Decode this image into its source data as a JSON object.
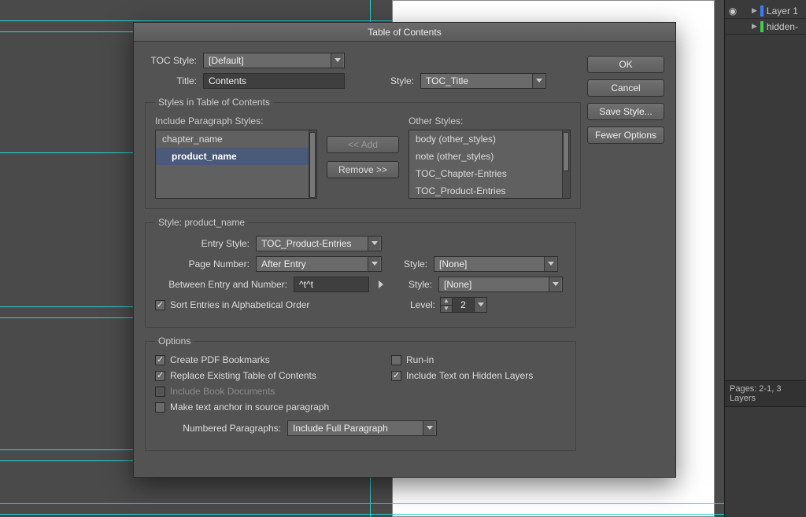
{
  "dialog": {
    "title": "Table of Contents",
    "toc_style_label": "TOC Style:",
    "toc_style_value": "[Default]",
    "title_label": "Title:",
    "title_value": "Contents",
    "title_style_label": "Style:",
    "title_style_value": "TOC_Title",
    "buttons": {
      "ok": "OK",
      "cancel": "Cancel",
      "save_style": "Save Style...",
      "fewer_options": "Fewer Options"
    },
    "styles_group": {
      "legend": "Styles in Table of Contents",
      "include_label": "Include Paragraph Styles:",
      "other_label": "Other Styles:",
      "include_list": [
        "chapter_name",
        "product_name"
      ],
      "include_selected": "product_name",
      "other_list": [
        "body (other_styles)",
        "note (other_styles)",
        "TOC_Chapter-Entries",
        "TOC_Product-Entries"
      ],
      "add_btn": "<< Add",
      "remove_btn": "Remove >>"
    },
    "style_detail": {
      "legend": "Style: product_name",
      "entry_style_label": "Entry Style:",
      "entry_style_value": "TOC_Product-Entries",
      "page_number_label": "Page Number:",
      "page_number_value": "After Entry",
      "page_number_style_label": "Style:",
      "page_number_style_value": "[None]",
      "between_label": "Between Entry and Number:",
      "between_value": "^t^t",
      "between_style_label": "Style:",
      "between_style_value": "[None]",
      "sort_label": "Sort Entries in Alphabetical Order",
      "sort_checked": true,
      "level_label": "Level:",
      "level_value": "2"
    },
    "options_group": {
      "legend": "Options",
      "pdf_bookmarks": {
        "label": "Create PDF Bookmarks",
        "checked": true
      },
      "run_in": {
        "label": "Run-in",
        "checked": false
      },
      "replace_existing": {
        "label": "Replace Existing Table of Contents",
        "checked": true
      },
      "hidden_layers": {
        "label": "Include Text on Hidden Layers",
        "checked": true
      },
      "book_docs": {
        "label": "Include Book Documents",
        "checked": false,
        "disabled": true
      },
      "text_anchor": {
        "label": "Make text anchor in source paragraph",
        "checked": false
      },
      "numbered_label": "Numbered Paragraphs:",
      "numbered_value": "Include Full Paragraph"
    }
  },
  "layers_panel": {
    "items": [
      {
        "name": "Layer 1",
        "color": "#3b7cff",
        "visible": true
      },
      {
        "name": "hidden-",
        "color": "#3bd24a",
        "visible": false
      }
    ],
    "status": "Pages: 2-1, 3 Layers"
  }
}
